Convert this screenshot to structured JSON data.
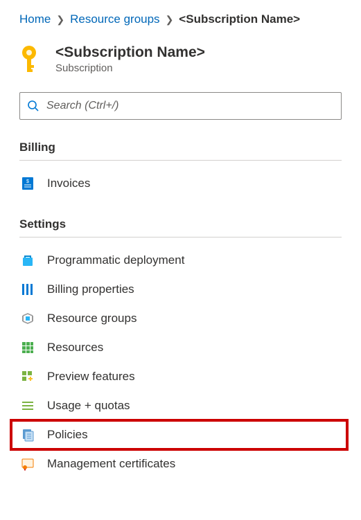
{
  "breadcrumb": {
    "home": "Home",
    "resource_groups": "Resource groups",
    "current": "<Subscription Name>"
  },
  "header": {
    "title": "<Subscription Name>",
    "subtitle": "Subscription"
  },
  "search": {
    "placeholder": "Search (Ctrl+/)"
  },
  "sections": {
    "billing": {
      "title": "Billing",
      "items": {
        "invoices": "Invoices"
      }
    },
    "settings": {
      "title": "Settings",
      "items": {
        "programmatic_deployment": "Programmatic deployment",
        "billing_properties": "Billing properties",
        "resource_groups": "Resource groups",
        "resources": "Resources",
        "preview_features": "Preview features",
        "usage_quotas": "Usage + quotas",
        "policies": "Policies",
        "management_certificates": "Management certificates"
      }
    }
  }
}
